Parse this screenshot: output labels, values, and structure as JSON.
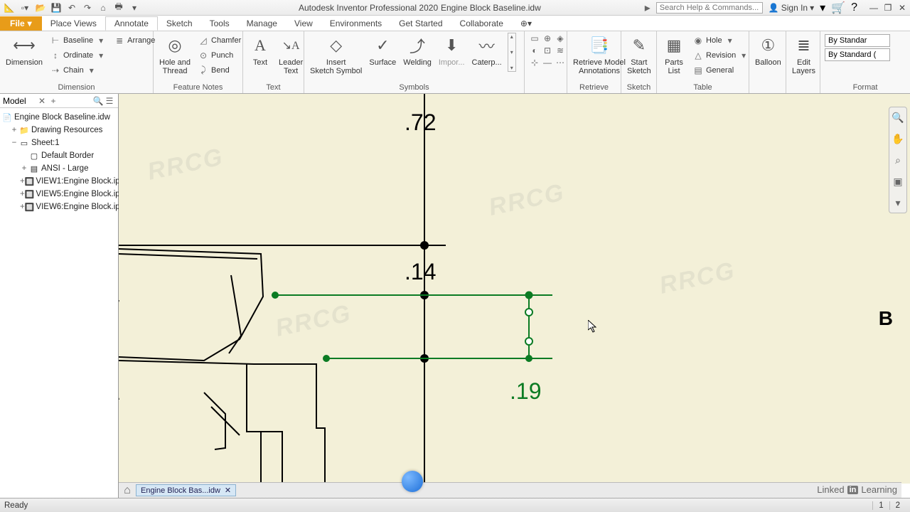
{
  "title": {
    "app": "Autodesk Inventor Professional 2020",
    "doc": "Engine Block Baseline.idw",
    "search_placeholder": "Search Help & Commands...",
    "signin": "Sign In"
  },
  "tabs": {
    "file": "File",
    "place_views": "Place Views",
    "annotate": "Annotate",
    "sketch": "Sketch",
    "tools": "Tools",
    "manage": "Manage",
    "view": "View",
    "environments": "Environments",
    "get_started": "Get Started",
    "collaborate": "Collaborate"
  },
  "ribbon": {
    "dimension": {
      "main": "Dimension",
      "baseline": "Baseline",
      "ordinate": "Ordinate",
      "chain": "Chain",
      "arrange": "Arrange",
      "panel": "Dimension"
    },
    "feature": {
      "hole_thread": "Hole and\nThread",
      "chamfer": "Chamfer",
      "punch": "Punch",
      "bend": "Bend",
      "panel": "Feature Notes"
    },
    "text": {
      "text": "Text",
      "leader": "Leader\nText",
      "panel": "Text"
    },
    "symbols": {
      "insert_sketch_symbol": "Insert\nSketch Symbol",
      "surface": "Surface",
      "welding": "Welding",
      "import": "Impor...",
      "caterp": "Caterp...",
      "panel": "Symbols"
    },
    "retrieve": {
      "retrieve_model": "Retrieve Model\nAnnotations",
      "panel": "Retrieve"
    },
    "sketch": {
      "start_sketch": "Start\nSketch",
      "panel": "Sketch"
    },
    "table": {
      "parts_list": "Parts\nList",
      "hole": "Hole",
      "revision": "Revision",
      "general": "General",
      "panel": "Table"
    },
    "balloon": "Balloon",
    "edit_layers": "Edit\nLayers",
    "format": {
      "by_standard1": "By Standar",
      "by_standard2": "By Standard (",
      "panel": "Format"
    }
  },
  "browser": {
    "title": "Model",
    "root": "Engine Block Baseline.idw",
    "drawing_resources": "Drawing Resources",
    "sheet": "Sheet:1",
    "default_border": "Default Border",
    "ansi": "ANSI - Large",
    "view1": "VIEW1:Engine Block.ipt",
    "view5": "VIEW5:Engine Block.ipt",
    "view6": "VIEW6:Engine Block.ipt"
  },
  "canvas": {
    "dim1": ".72",
    "dim2": ".14",
    "dim3": ".19",
    "view_letter": "B"
  },
  "doctab": {
    "name": "Engine Block Bas...idw"
  },
  "status": {
    "ready": "Ready",
    "n1": "1",
    "n2": "2"
  },
  "logos": {
    "linkedin": "Linked",
    "learning": "Learning"
  }
}
